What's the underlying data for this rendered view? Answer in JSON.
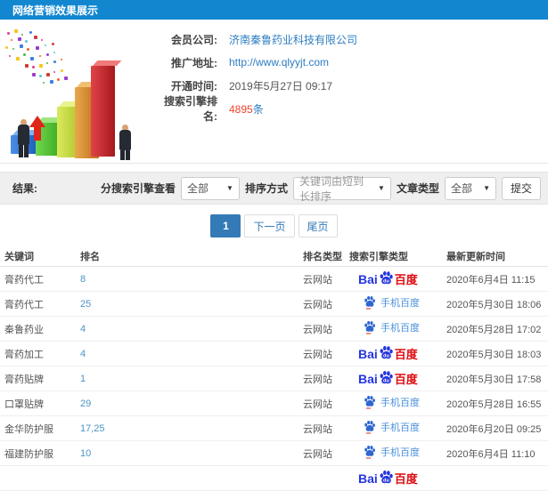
{
  "header": {
    "title": "网络营销效果展示"
  },
  "info": {
    "fields": [
      {
        "label": "会员公司:",
        "value": "济南秦鲁药业科技有限公司"
      },
      {
        "label": "推广地址:",
        "value": "http://www.qlyyjt.com"
      },
      {
        "label": "开通时间:",
        "value": "2019年5月27日 09:17"
      },
      {
        "label": "搜索引擎排名:",
        "value": "4895",
        "suffix": "条"
      }
    ]
  },
  "filters": {
    "result_label": "结果:",
    "engine_label": "分搜索引擎查看",
    "engine_value": "全部",
    "sort_label": "排序方式",
    "sort_value": "关键词由短到长排序",
    "article_label": "文章类型",
    "article_value": "全部",
    "submit_label": "提交"
  },
  "pagination": {
    "current": "1",
    "next": "下一页",
    "last": "尾页"
  },
  "table": {
    "headers": [
      "关键词",
      "排名",
      "排名类型",
      "搜索引擎类型",
      "最新更新时间"
    ],
    "engine_labels": {
      "baidu_pc_bai": "Bai",
      "baidu_pc_du": "du",
      "baidu_pc_name": "百度",
      "baidu_mobile_name": "手机百度"
    },
    "rows": [
      {
        "keyword": "膏药代工",
        "rank": "8",
        "rank_type": "云网站",
        "engine": "baidu-pc",
        "updated": "2020年6月4日 11:15"
      },
      {
        "keyword": "膏药代工",
        "rank": "25",
        "rank_type": "云网站",
        "engine": "baidu-mobile",
        "updated": "2020年5月30日 18:06"
      },
      {
        "keyword": "秦鲁药业",
        "rank": "4",
        "rank_type": "云网站",
        "engine": "baidu-mobile",
        "updated": "2020年5月28日 17:02"
      },
      {
        "keyword": "膏药加工",
        "rank": "4",
        "rank_type": "云网站",
        "engine": "baidu-pc",
        "updated": "2020年5月30日 18:03"
      },
      {
        "keyword": "膏药贴牌",
        "rank": "1",
        "rank_type": "云网站",
        "engine": "baidu-pc",
        "updated": "2020年5月30日 17:58"
      },
      {
        "keyword": "口罩贴牌",
        "rank": "29",
        "rank_type": "云网站",
        "engine": "baidu-mobile",
        "updated": "2020年5月28日 16:55"
      },
      {
        "keyword": "金华防护服",
        "rank": "17,25",
        "rank_type": "云网站",
        "engine": "baidu-mobile",
        "updated": "2020年6月20日 09:25"
      },
      {
        "keyword": "福建防护服",
        "rank": "10",
        "rank_type": "云网站",
        "engine": "baidu-mobile",
        "updated": "2020年6月4日 11:10"
      },
      {
        "keyword": "",
        "rank": "",
        "rank_type": "",
        "engine": "baidu-pc",
        "updated": ""
      }
    ]
  },
  "colors": {
    "titlebar_bg": "#1287d0",
    "link_blue": "#2d7dc1",
    "rank_count_red": "#f0442c",
    "rank_link_blue": "#4b95c6",
    "pagination_active": "#337ab7",
    "baidu_blue": "#2534de",
    "baidu_red": "#dd0b10",
    "baidu_mobile_blue": "#4a90d9",
    "filterbar_bg": "#efefef"
  }
}
